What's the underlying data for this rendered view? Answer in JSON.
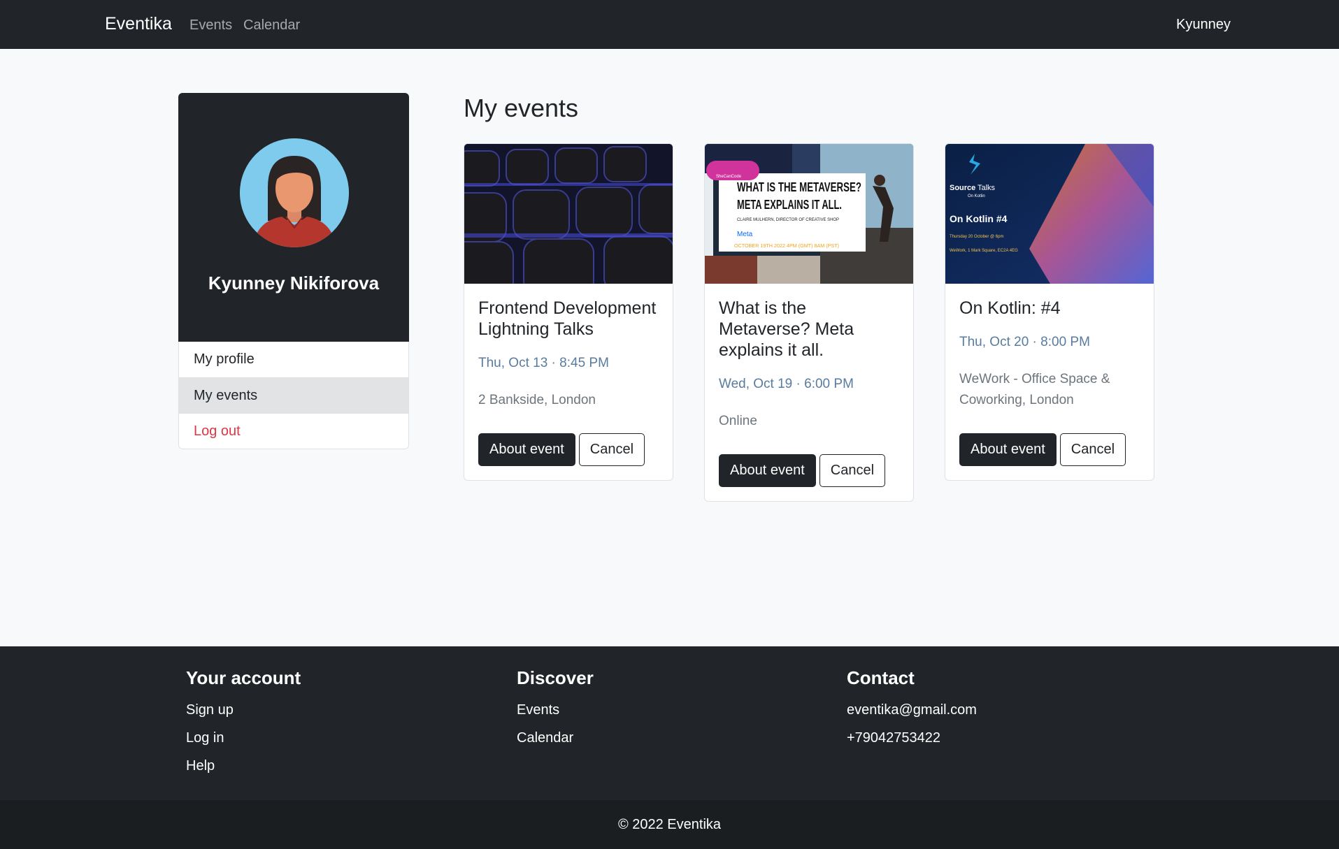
{
  "navbar": {
    "brand": "Eventika",
    "links": [
      "Events",
      "Calendar"
    ],
    "user": "Kyunney"
  },
  "profile": {
    "name": "Kyunney Nikiforova"
  },
  "sidebar": {
    "items": [
      {
        "label": "My profile"
      },
      {
        "label": "My events"
      },
      {
        "label": "Log out"
      }
    ]
  },
  "main": {
    "heading": "My events",
    "events": [
      {
        "title": "Frontend Development Lightning Talks",
        "date": "Thu, Oct 13 · 8:45 PM",
        "location": "2 Bankside, London",
        "about_label": "About event",
        "cancel_label": "Cancel"
      },
      {
        "title": "What is the Metaverse? Meta explains it all.",
        "date": "Wed, Oct 19 · 6:00 PM",
        "location": "Online",
        "about_label": "About event",
        "cancel_label": "Cancel",
        "poster": {
          "badge": "SheCanCode",
          "headline1": "WHAT IS THE METAVERSE?",
          "headline2": "META EXPLAINS IT ALL.",
          "speaker": "CLAIRE MULHERN, DIRECTOR OF CREATIVE SHOP",
          "brand": "Meta",
          "when": "OCTOBER 19TH 2022 4PM (GMT) 8AM (PST)"
        }
      },
      {
        "title": "On Kotlin: #4",
        "date": "Thu, Oct 20 · 8:00 PM",
        "location": "WeWork - Office Space & Coworking, London",
        "about_label": "About event",
        "cancel_label": "Cancel",
        "poster": {
          "brand_bold": "Source",
          "brand_rest": "Talks",
          "sub": "On Kotlin",
          "headline": "On Kotlin #4",
          "when": "Thursday 20 October @ 6pm",
          "where": "WeWork, 1 Mark Square, EC2A 4EG"
        }
      }
    ]
  },
  "footer": {
    "columns": [
      {
        "heading": "Your account",
        "links": [
          "Sign up",
          "Log in",
          "Help"
        ]
      },
      {
        "heading": "Discover",
        "links": [
          "Events",
          "Calendar"
        ]
      },
      {
        "heading": "Contact",
        "links": [
          "eventika@gmail.com",
          "+79042753422"
        ]
      }
    ],
    "copyright": "© 2022 Eventika"
  },
  "colors": {
    "dark": "#212529",
    "page_bg": "#f8f9fa",
    "date_text": "#587c9f",
    "danger": "#dc3545",
    "avatar_bg": "#7fcbee"
  }
}
